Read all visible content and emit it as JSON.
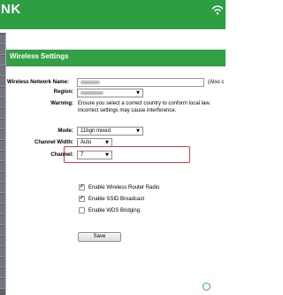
{
  "header": {
    "brand": "NK"
  },
  "section": {
    "title": "Wireless Settings"
  },
  "form": {
    "network_name": {
      "label": "Wireless Network Name:",
      "hint": "(Also c"
    },
    "region": {
      "label": "Region:"
    },
    "warning": {
      "label": "Warning:",
      "line1": "Ensure you select a correct country to conform local law.",
      "line2": "Incorrect settings may cause interference."
    },
    "mode": {
      "label": "Mode:",
      "value": "11bgn mixed"
    },
    "channel_width": {
      "label": "Channel Width:",
      "value": "Auto"
    },
    "channel": {
      "label": "Channel:",
      "value": "7"
    },
    "options": [
      {
        "label": "Enable Wireless Router Radio",
        "checked": true
      },
      {
        "label": "Enable SSID Broadcast",
        "checked": true
      },
      {
        "label": "Enable WDS Bridging",
        "checked": false
      }
    ],
    "save_label": "Save"
  },
  "colors": {
    "brand_green": "#2e9e43",
    "highlight_red": "#e23a3a"
  }
}
